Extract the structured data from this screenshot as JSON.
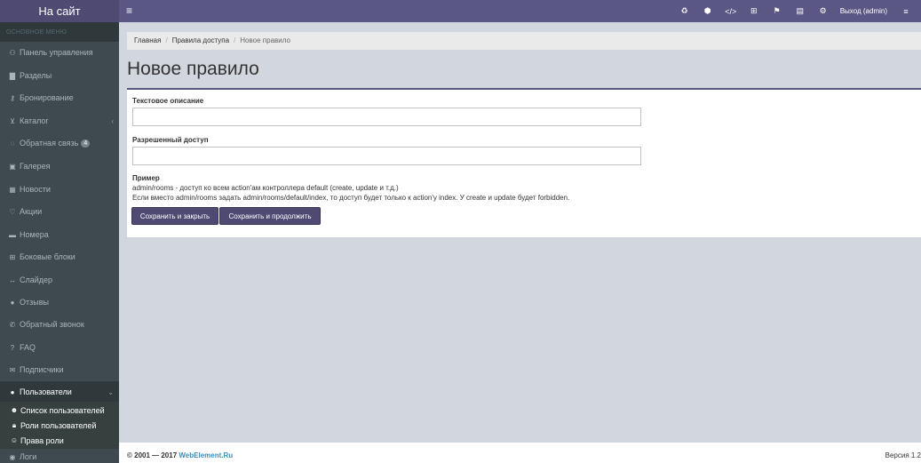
{
  "header": {
    "site_link": "На сайт",
    "menu_toggle": "≡",
    "icons": [
      "recycle-icon",
      "cubes-icon",
      "code-icon",
      "blocks-icon",
      "flag-icon",
      "file-icon",
      "cogs-icon"
    ],
    "logout": "Выход (admin)",
    "more_toggle": "≡"
  },
  "sidebar": {
    "header": "ОСНОВНОЕ МЕНЮ",
    "items": [
      {
        "label": "Панель управления",
        "icon": "dashboard-icon"
      },
      {
        "label": "Разделы",
        "icon": "file-icon"
      },
      {
        "label": "Бронирование",
        "icon": "key-icon"
      },
      {
        "label": "Каталог",
        "icon": "cart-icon",
        "chevron": "‹"
      },
      {
        "label": "Обратная связь",
        "icon": "comments-icon",
        "badge": "4"
      },
      {
        "label": "Галерея",
        "icon": "image-icon"
      },
      {
        "label": "Новости",
        "icon": "newspaper-icon"
      },
      {
        "label": "Акции",
        "icon": "heart-icon"
      },
      {
        "label": "Номера",
        "icon": "bed-icon"
      },
      {
        "label": "Боковые блоки",
        "icon": "blocks-icon"
      },
      {
        "label": "Слайдер",
        "icon": "arrows-h-icon"
      },
      {
        "label": "Отзывы",
        "icon": "comment-icon"
      },
      {
        "label": "Обратный звонок",
        "icon": "phone-icon"
      },
      {
        "label": "FAQ",
        "icon": "question-icon"
      },
      {
        "label": "Подписчики",
        "icon": "envelope-icon"
      },
      {
        "label": "Пользователи",
        "icon": "user-icon",
        "chevron": "⌄"
      }
    ],
    "subitems": [
      {
        "label": "Список пользователей",
        "icon": "users-icon"
      },
      {
        "label": "Роли пользователей",
        "icon": "lock-icon"
      },
      {
        "label": "Права роли",
        "icon": "user-plus-icon"
      }
    ],
    "last_item": {
      "label": "Логи",
      "icon": "eye-icon"
    }
  },
  "breadcrumb": {
    "home": "Главная",
    "section": "Правила доступа",
    "current": "Новое правило",
    "separator": "/"
  },
  "page_title": "Новое правило",
  "form": {
    "description_label": "Текстовое описание",
    "description_value": "",
    "access_label": "Разрешенный доступ",
    "access_value": "",
    "example_title": "Пример",
    "example_line1": "admin/rooms - доступ ко всем action'ам контроллера default (create, update и т.д.)",
    "example_line2": "Если вместо admin/rooms задать admin/rooms/default/index, то доступ будет только к action'у index. У create и update будет forbidden.",
    "save_close": "Сохранить и закрыть",
    "save_continue": "Сохранить и продолжить"
  },
  "footer": {
    "copyright": "© 2001 — 2017",
    "brand": "WebElement.Ru",
    "version": "Версия 1.2"
  },
  "colors": {
    "accent": "#5b5784",
    "sidebar": "#3f4a4f",
    "button": "#4e4a72"
  }
}
